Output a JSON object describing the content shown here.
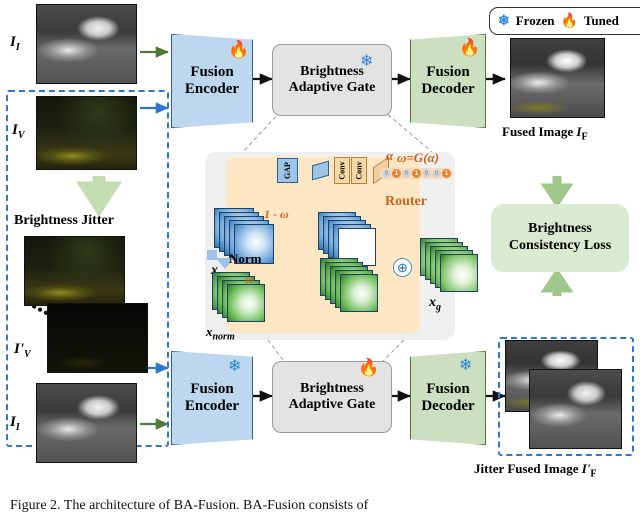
{
  "figure": {
    "caption": "Figure 2.  The architecture of BA-Fusion. BA-Fusion consists of"
  },
  "legend": {
    "frozen_label": "Frozen",
    "tuned_label": "Tuned",
    "frozen_icon": "snowflake-icon",
    "tuned_icon": "flame-icon"
  },
  "inputs": {
    "ir_top_label": "I",
    "ir_top_sub": "I",
    "vis_label": "I",
    "vis_sub": "V",
    "jitter_label": "Brightness Jitter",
    "vis_jitter_label": "I'",
    "vis_jitter_sub": "V",
    "ir_bottom_label": "I",
    "ir_bottom_sub": "I",
    "ellipsis": "•••"
  },
  "pipeline_top": {
    "encoder": {
      "line1": "Fusion",
      "line2": "Encoder",
      "state": "tuned"
    },
    "gate": {
      "line1": "Brightness",
      "line2": "Adaptive Gate",
      "state": "frozen"
    },
    "decoder": {
      "line1": "Fusion",
      "line2": "Decoder",
      "state": "tuned"
    }
  },
  "pipeline_bottom": {
    "encoder": {
      "line1": "Fusion",
      "line2": "Encoder",
      "state": "frozen"
    },
    "gate": {
      "line1": "Brightness",
      "line2": "Adaptive Gate",
      "state": "tuned"
    },
    "decoder": {
      "line1": "Fusion",
      "line2": "Decoder",
      "state": "frozen"
    }
  },
  "outputs": {
    "fused_label": "Fused Image",
    "fused_symbol": "I",
    "fused_sub": "F",
    "jitter_fused_label": "Jitter Fused Image",
    "jitter_fused_symbol": "I'",
    "jitter_fused_sub": "F"
  },
  "loss": {
    "line1": "Brightness",
    "line2": "Consistency Loss"
  },
  "gate_detail": {
    "gap_label": "GAP",
    "conv1_label": "Conv",
    "conv2_label": "Conv",
    "alpha_label": "α",
    "omega_formula": "ω=G(α)",
    "router_label": "Router",
    "gate_bits": [
      0,
      1,
      0,
      1,
      0,
      0,
      1
    ],
    "input_label": "x",
    "norm_label": "Norm",
    "norm_output_label": "x",
    "norm_output_sub": "norm",
    "weight_inverse_label": "1 - ω",
    "weight_label": "ω",
    "sum_symbol": "⊕",
    "output_label": "x",
    "output_sub": "g"
  },
  "colors": {
    "encoder_fill": "#bdd7ee",
    "decoder_fill": "#ccdfc0",
    "gate_fill": "#e3e3e3",
    "loss_fill": "#d9ead0",
    "router_fill": "#fde6c4",
    "panel_fill": "#efefef",
    "accent_orange": "#e8822a",
    "accent_blue": "#2e75d4",
    "accent_green": "#5a8a3c",
    "flame": "#e8262a",
    "snowflake": "#2f84d6"
  }
}
